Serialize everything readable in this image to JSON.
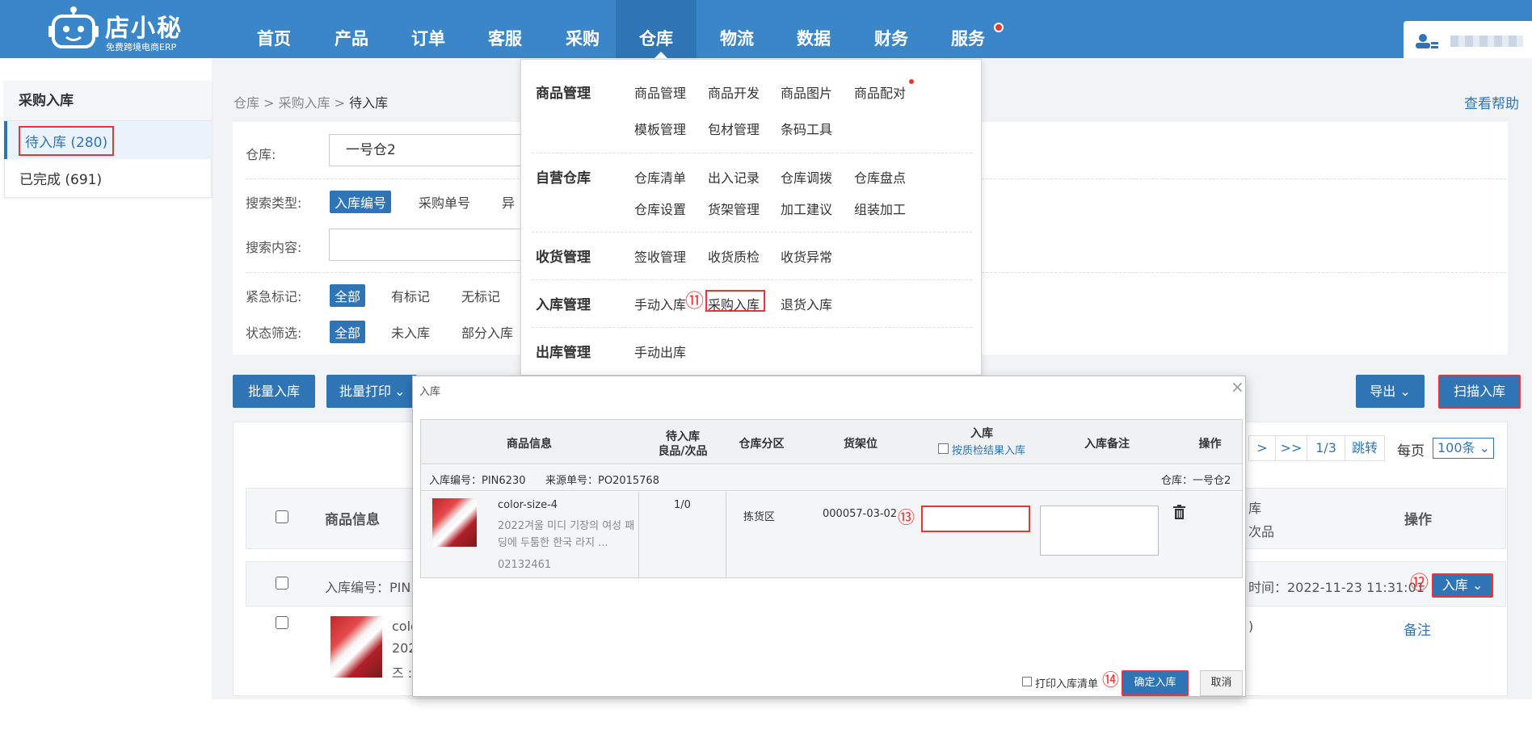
{
  "app": {
    "logo_title": "店小秘",
    "logo_subtitle": "免费跨境电商ERP"
  },
  "nav": {
    "items": [
      {
        "label": "首页"
      },
      {
        "label": "产品"
      },
      {
        "label": "订单"
      },
      {
        "label": "客服"
      },
      {
        "label": "采购"
      },
      {
        "label": "仓库",
        "active": true
      },
      {
        "label": "物流"
      },
      {
        "label": "数据"
      },
      {
        "label": "财务"
      },
      {
        "label": "服务",
        "has_dot": true
      }
    ]
  },
  "sidebar": {
    "title": "采购入库",
    "items": [
      {
        "label": "待入库 (280)",
        "active": true
      },
      {
        "label": "已完成 (691)"
      }
    ]
  },
  "breadcrumb": {
    "path": "仓库 > 采购入库 > ",
    "current": "待入库"
  },
  "help_link": "查看帮助",
  "filters": {
    "warehouse_label": "仓库:",
    "warehouse_value": "一号仓2",
    "search_type_label": "搜索类型:",
    "search_type_options": [
      "入库编号",
      "采购单号",
      "异"
    ],
    "search_content_label": "搜索内容:",
    "urgent_label": "紧急标记:",
    "urgent_options": [
      "全部",
      "有标记",
      "无标记"
    ],
    "status_label": "状态筛选:",
    "status_options": [
      "全部",
      "未入库",
      "部分入库"
    ]
  },
  "toolbar": {
    "batch_in": "批量入库",
    "batch_print": "批量打印",
    "export": "导出",
    "scan_in": "扫描入库"
  },
  "pagination": {
    "next": ">",
    "last": ">>",
    "page": "1/3",
    "jump": "跳转",
    "per_page_label": "每页",
    "per_page_value": "100条"
  },
  "table": {
    "col_product": "商品信息",
    "col_stock_line1": "库",
    "col_stock_line2": "次品",
    "col_ops": "操作",
    "row": {
      "in_no_label": "入库编号：PIN",
      "time_text": "时间：2022-11-23 11:31:01",
      "in_button": "入库",
      "product_partial_1": "colo",
      "product_partial_2": "202",
      "product_partial_3": "즈 :",
      "qty_partial": ")",
      "note": "备注"
    }
  },
  "mega_menu": {
    "sections": [
      {
        "title": "商品管理",
        "items": [
          "商品管理",
          "商品开发",
          "商品图片",
          "商品配对",
          "模板管理",
          "包材管理",
          "条码工具"
        ]
      },
      {
        "title": "自营仓库",
        "items": [
          "仓库清单",
          "出入记录",
          "仓库调拨",
          "仓库盘点",
          "仓库设置",
          "货架管理",
          "加工建议",
          "组装加工"
        ]
      },
      {
        "title": "收货管理",
        "items": [
          "签收管理",
          "收货质检",
          "收货异常"
        ]
      },
      {
        "title": "入库管理",
        "items": [
          "手动入库",
          "采购入库",
          "退货入库"
        ]
      },
      {
        "title": "出库管理",
        "items": [
          "手动出库"
        ]
      }
    ]
  },
  "annotations": {
    "n11": "⑪",
    "n12": "⑫",
    "n13": "⑬",
    "n14": "⑭"
  },
  "modal": {
    "title": "入库",
    "close": "×",
    "headers": {
      "product": "商品信息",
      "pending_line1": "待入库",
      "pending_line2": "良品/次品",
      "zone": "仓库分区",
      "location": "货架位",
      "in_qty": "入库",
      "qc_option": "按质检结果入库",
      "note": "入库备注",
      "ops": "操作"
    },
    "info": {
      "in_no": "入库编号：PIN6230",
      "source_no": "来源单号：PO2015768",
      "warehouse": "仓库：一号仓2"
    },
    "item": {
      "sku": "color-size-4",
      "title": "2022겨울 미디 기장의 여성 패딩에 두툼한 한국 라지 ...",
      "code": "02132461",
      "pending": "1/0",
      "zone": "拣货区",
      "location": "000057-03-02"
    },
    "footer": {
      "print_list": "打印入库清单",
      "confirm": "确定入库",
      "cancel": "取消"
    }
  },
  "colors": {
    "primary": "#3a86c8",
    "dark_primary": "#2f75b5",
    "highlight": "#e33333"
  }
}
